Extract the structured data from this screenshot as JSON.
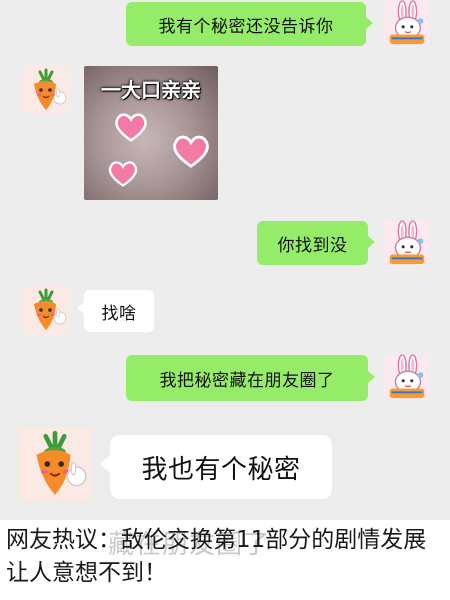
{
  "chat": {
    "messages": [
      {
        "side": "right",
        "text": "我有个秘密还没告诉你"
      },
      {
        "side": "left",
        "type": "sticker",
        "text": "一大口亲亲"
      },
      {
        "side": "right",
        "text": "你找到没"
      },
      {
        "side": "left",
        "text": "找啥"
      },
      {
        "side": "right",
        "text": "我把秘密藏在朋友圈了"
      }
    ]
  },
  "zoom": {
    "side": "left",
    "text": "我也有个秘密"
  },
  "caption": {
    "ghost": "藏在朋友圈了",
    "text": "网友热议：敌伦交换第11部分的剧情发展让人意想不到！"
  },
  "colors": {
    "chat_background": "#ededed",
    "outgoing_bubble": "#95ec69",
    "incoming_bubble": "#ffffff",
    "heart": "#f47aa6"
  },
  "icons": {
    "me_avatar": "bunny-avatar-icon",
    "friend_avatar": "carrot-avatar-icon"
  }
}
